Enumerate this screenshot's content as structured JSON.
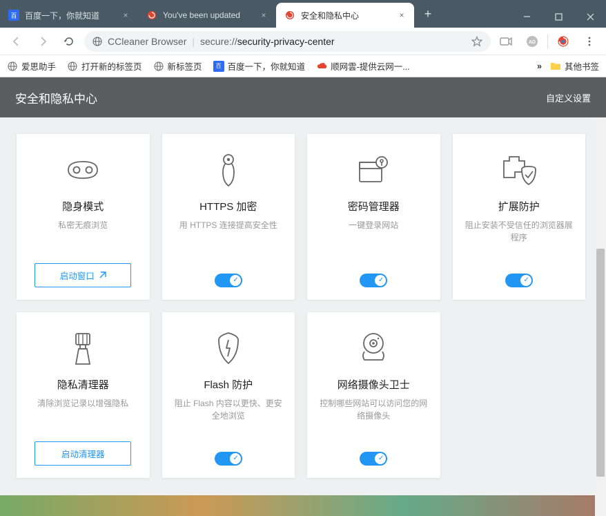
{
  "window": {
    "tabs": [
      {
        "label": "百度一下，你就知道",
        "favicon_color": "#2f6af5"
      },
      {
        "label": "You've been updated",
        "favicon_color": "#e2452f"
      },
      {
        "label": "安全和隐私中心",
        "favicon_color": "#e2452f"
      }
    ]
  },
  "toolbar": {
    "site_label": "CCleaner Browser",
    "url_scheme": "secure://",
    "url_path": "security-privacy-center"
  },
  "bookmarks": {
    "items": [
      {
        "label": "爱思助手"
      },
      {
        "label": "打开新的标签页"
      },
      {
        "label": "新标签页"
      },
      {
        "label": "百度一下，你就知道"
      },
      {
        "label": "顺网雲-提供云网一..."
      }
    ],
    "overflow_label": "其他书签"
  },
  "page": {
    "title": "安全和隐私中心",
    "customize": "自定义设置"
  },
  "cards": [
    {
      "title": "隐身模式",
      "desc": "私密无痕浏览",
      "action_type": "button",
      "action_label": "启动窗口"
    },
    {
      "title": "HTTPS 加密",
      "desc": "用 HTTPS 连接提高安全性",
      "action_type": "toggle"
    },
    {
      "title": "密码管理器",
      "desc": "一键登录网站",
      "action_type": "toggle"
    },
    {
      "title": "扩展防护",
      "desc": "阻止安装不受信任的浏览器展程序",
      "action_type": "toggle"
    },
    {
      "title": "隐私清理器",
      "desc": "清除浏览记录以增强隐私",
      "action_type": "button",
      "action_label": "启动清理器"
    },
    {
      "title": "Flash 防护",
      "desc": "阻止 Flash 内容以更快、更安全地浏览",
      "action_type": "toggle"
    },
    {
      "title": "网络摄像头卫士",
      "desc": "控制哪些网站可以访问您的网络摄像头",
      "action_type": "toggle"
    }
  ]
}
